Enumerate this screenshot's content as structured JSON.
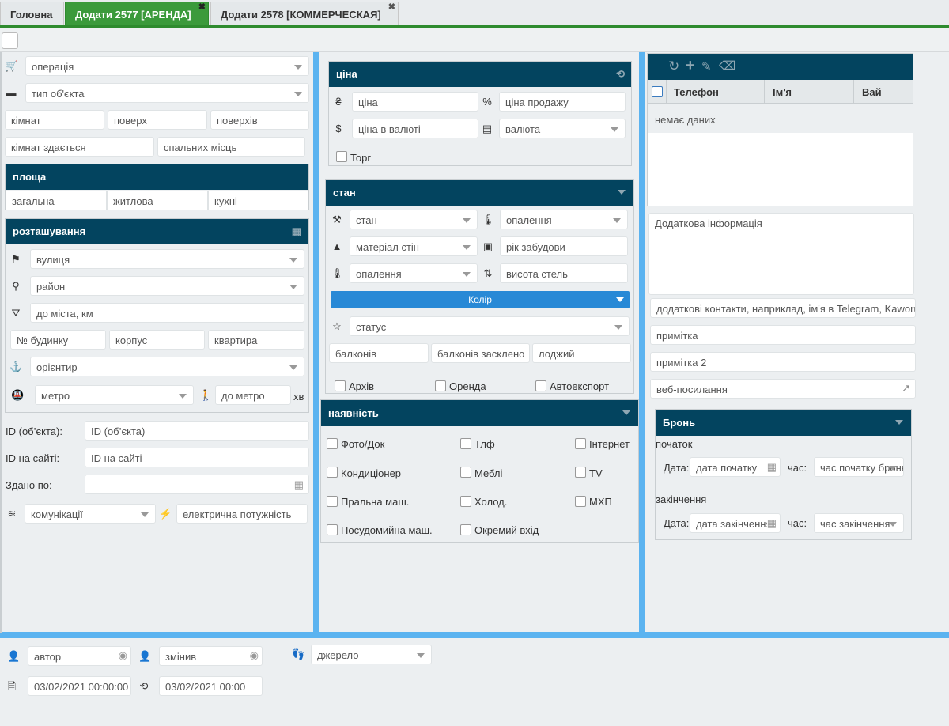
{
  "tabs": [
    {
      "label": "Головна"
    },
    {
      "label": "Додати 2577 [АРЕНДА]"
    },
    {
      "label": "Додати 2578 [КОММЕРЧЕСКАЯ]"
    }
  ],
  "left": {
    "operation": "операція",
    "object_type": "тип об'єкта",
    "rooms": "кімнат",
    "floor": "поверх",
    "floors": "поверхів",
    "rooms_rent": "кімнат здається",
    "sleeping": "спальних місць",
    "area_title": "площа",
    "area_total": "загальна",
    "area_living": "житлова",
    "area_kitchen": "кухні",
    "location_title": "розташування",
    "street": "вулиця",
    "district": "район",
    "to_city": "до міста, км",
    "house_no": "№ будинку",
    "building": "корпус",
    "apartment": "квартира",
    "landmark": "орієнтир",
    "metro": "метро",
    "to_metro": "до метро",
    "min_unit": "хв",
    "id_obj_label": "ID (об’єкта):",
    "id_obj_ph": "ID (об’єкта)",
    "id_site_label": "ID на сайті:",
    "id_site_ph": "ID на сайті",
    "rented_label": "Здано по:",
    "communications": "комунікації",
    "power": "електрична потужність"
  },
  "middle": {
    "price_title": "ціна",
    "price": "ціна",
    "sale_price": "ціна продажу",
    "price_currency": "ціна в валюті",
    "currency": "валюта",
    "bargain": "Торг",
    "state_title": "стан",
    "state": "стан",
    "heating1": "опалення",
    "wall_material": "матеріал стін",
    "build_year": "рік забудови",
    "heating2": "опалення",
    "ceiling": "висота стель",
    "color_btn": "Колір",
    "status": "статус",
    "balconies": "балконів",
    "balconies_glazed": "балконів засклено",
    "loggias": "лоджий",
    "archive": "Архів",
    "rent": "Оренда",
    "autoexport": "Автоекспорт",
    "avail_title": "наявність",
    "avail": [
      "Фото/Док",
      "Тлф",
      "Інтернет",
      "Кондиціонер",
      "Меблі",
      "TV",
      "Пральна маш.",
      "Холод.",
      "МХП",
      "Посудомийна маш.",
      "Окремий вхід"
    ]
  },
  "right": {
    "col_phone": "Телефон",
    "col_name": "Ім'я",
    "col_vai": "Вай",
    "empty": "немає даних",
    "extra_info": "Додаткова інформація",
    "extra_contacts": "додаткові контакти, наприклад, ім'я в Telegram, Kaworu",
    "note": "примітка",
    "note2": "примітка 2",
    "web_link": "веб-посилання",
    "booking_title": "Бронь",
    "start": "початок",
    "date_label": "Дата:",
    "time_label": "час:",
    "start_date": "дата початку",
    "start_time": "час початку бронювання",
    "end": "закінчення",
    "end_date": "дата закінчення",
    "end_time": "час закінчення"
  },
  "bottom": {
    "author": "автор",
    "changed": "змінив",
    "source": "джерело",
    "created": "03/02/2021 00:00:00",
    "modified": "03/02/2021 00:00"
  }
}
